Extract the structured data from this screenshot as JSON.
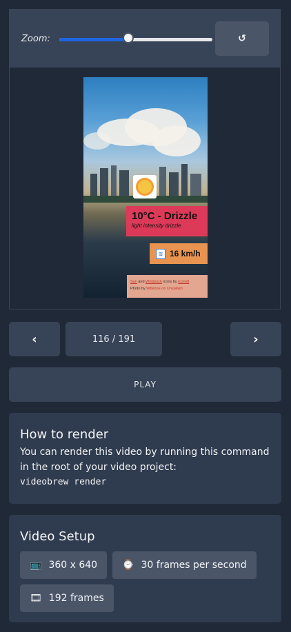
{
  "zoom": {
    "label": "Zoom:",
    "level": 0.45,
    "reset_icon": "↺"
  },
  "preview": {
    "weather_icon": "sun-icon",
    "temperature": "10°C - Drizzle",
    "description": "light intensity drizzle",
    "wind_icon": "windsock-icon",
    "wind": "16 km/h",
    "credits": {
      "sun": "Sun",
      "and": "and",
      "windsock": "Windsock",
      "icons_by": "icons by",
      "icons8": "Icons8",
      "photo_by": "Photo by",
      "photographer": "Wbenne on Unsplash"
    }
  },
  "nav": {
    "prev_label": "‹",
    "counter": "116 / 191",
    "next_label": "›"
  },
  "play_label": "PLAY",
  "how_to_render": {
    "title": "How to render",
    "text": "You can render this video by running this command in the root of your video project:",
    "command": "videobrew render"
  },
  "video_setup": {
    "title": "Video Setup",
    "resolution": "360 x 640",
    "fps": "30 frames per second",
    "frames": "192 frames",
    "resolution_icon": "📺",
    "fps_icon": "⌚",
    "frames_icon": "🎞"
  },
  "colors": {
    "accent": "#1e66e0",
    "temp_bg": "#dc3a58",
    "wind_bg": "#e8934f",
    "credit_bg": "#e3a690"
  }
}
